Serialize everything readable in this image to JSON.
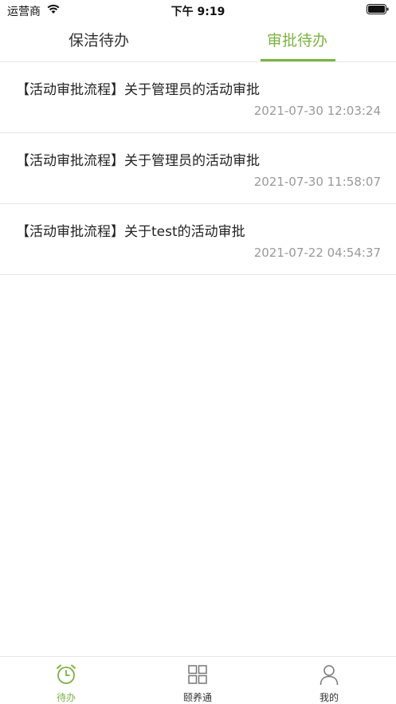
{
  "status_bar": {
    "carrier": "运营商",
    "time": "下午 9:19"
  },
  "tabs": [
    {
      "label": "保洁待办",
      "active": false
    },
    {
      "label": "审批待办",
      "active": true
    }
  ],
  "items": [
    {
      "title": "【活动审批流程】关于管理员的活动审批",
      "time": "2021-07-30 12:03:24"
    },
    {
      "title": "【活动审批流程】关于管理员的活动审批",
      "time": "2021-07-30 11:58:07"
    },
    {
      "title": "【活动审批流程】关于test的活动审批",
      "time": "2021-07-22 04:54:37"
    }
  ],
  "bottom_nav": [
    {
      "label": "待办",
      "icon": "alarm-clock-icon",
      "active": true
    },
    {
      "label": "颐养通",
      "icon": "grid-icon",
      "active": false
    },
    {
      "label": "我的",
      "icon": "user-icon",
      "active": false
    }
  ],
  "colors": {
    "accent": "#7cb342",
    "divider": "#e6e6e6",
    "muted_text": "#999999"
  }
}
